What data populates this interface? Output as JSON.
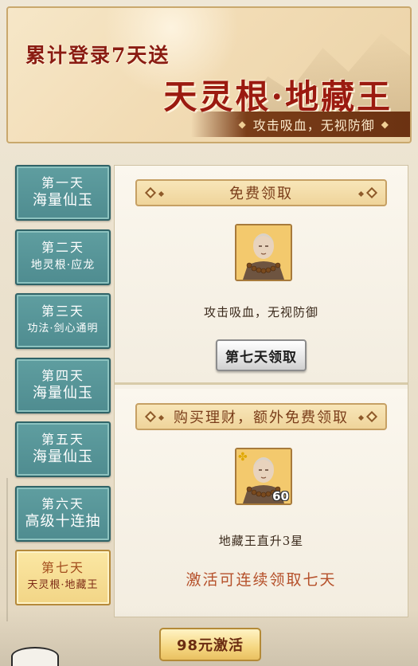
{
  "banner": {
    "title_line1": "累计登录7天送",
    "title_line2": "天灵根·地藏王",
    "subtitle": "攻击吸血，无视防御",
    "diamond_glyph": "◆"
  },
  "days": [
    {
      "day": "第一天",
      "reward": "海量仙玉",
      "active": false
    },
    {
      "day": "第二天",
      "reward": "地灵根·应龙",
      "active": false
    },
    {
      "day": "第三天",
      "reward": "功法·剑心通明",
      "active": false
    },
    {
      "day": "第四天",
      "reward": "海量仙玉",
      "active": false
    },
    {
      "day": "第五天",
      "reward": "海量仙玉",
      "active": false
    },
    {
      "day": "第六天",
      "reward": "高级十连抽",
      "active": false
    },
    {
      "day": "第七天",
      "reward": "天灵根·地藏王",
      "active": true
    }
  ],
  "free_section": {
    "header": "免费领取",
    "description": "攻击吸血，无视防御",
    "claim_button": "第七天领取"
  },
  "paid_section": {
    "header": "购买理财，额外免费领取",
    "avatar_level": "60",
    "description": "地藏王直升3星",
    "note": "激活可连续领取七天"
  },
  "activate_button": "98元激活",
  "colors": {
    "tab_teal": "#5f9ea0",
    "tab_active_gold": "#f2d586",
    "title_red": "#9b1a10",
    "note_orange": "#b5502a"
  }
}
